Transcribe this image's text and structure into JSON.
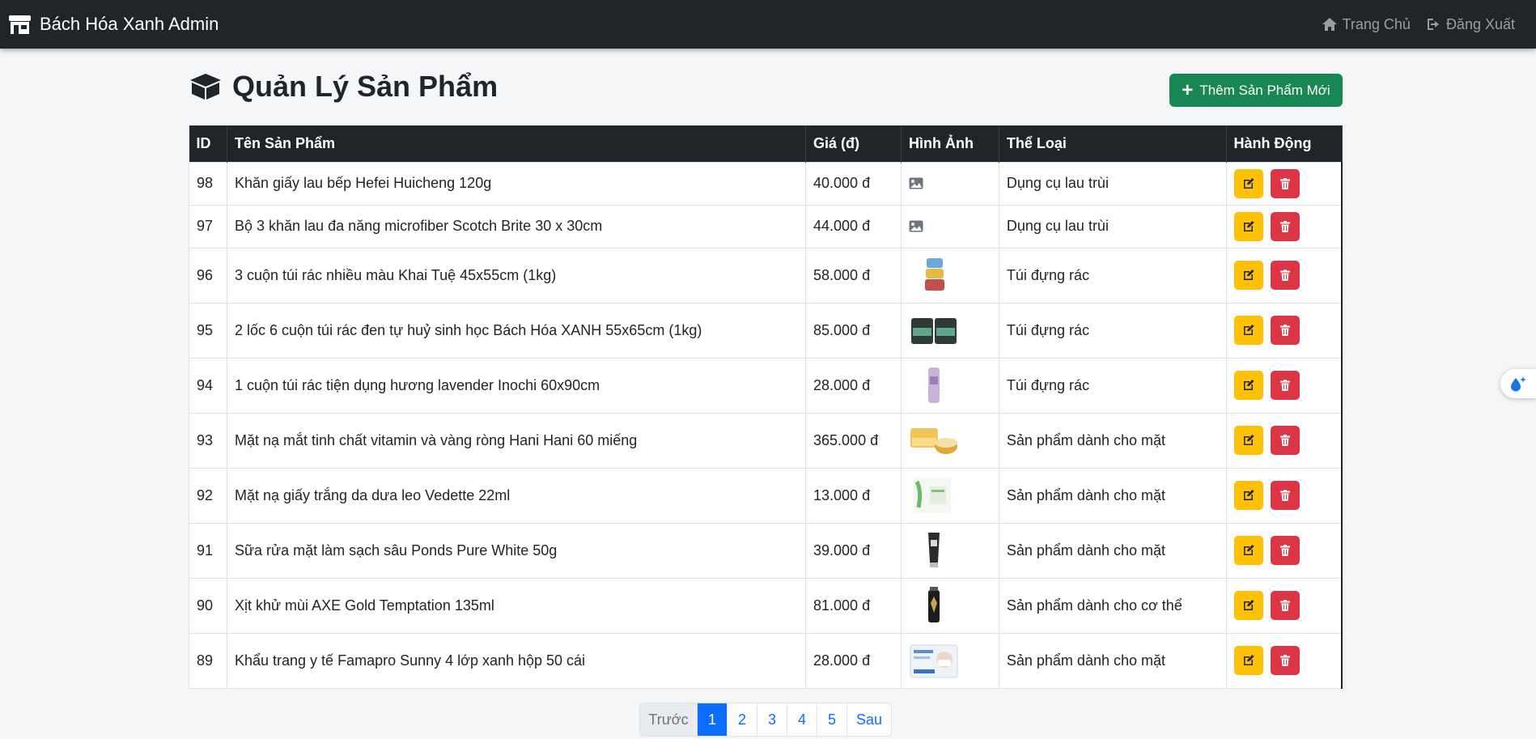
{
  "navbar": {
    "brand": "Bách Hóa Xanh Admin",
    "home_label": "Trang Chủ",
    "logout_label": "Đăng Xuất"
  },
  "page": {
    "title": "Quản Lý Sản Phẩm",
    "add_button": "Thêm Sản Phẩm Mới"
  },
  "table": {
    "headers": {
      "id": "ID",
      "name": "Tên Sản Phẩm",
      "price": "Giá (đ)",
      "image": "Hình Ảnh",
      "category": "Thể Loại",
      "actions": "Hành Động"
    },
    "rows": [
      {
        "id": "98",
        "name": "Khăn giấy lau bếp Hefei Huicheng 120g",
        "price": "40.000 đ",
        "image": "image-placeholder-icon",
        "category": "Dụng cụ lau trùi"
      },
      {
        "id": "97",
        "name": "Bộ 3 khăn lau đa năng microfiber Scotch Brite 30 x 30cm",
        "price": "44.000 đ",
        "image": "image-placeholder-icon",
        "category": "Dụng cụ lau trùi"
      },
      {
        "id": "96",
        "name": "3 cuộn túi rác nhiều màu Khai Tuệ 45x55cm (1kg)",
        "price": "58.000 đ",
        "image": "trash-bag-rolls",
        "category": "Túi đựng rác"
      },
      {
        "id": "95",
        "name": "2 lốc 6 cuộn túi rác đen tự huỷ sinh học Bách Hóa XANH 55x65cm (1kg)",
        "price": "85.000 đ",
        "image": "black-bag-packs",
        "category": "Túi đựng rác"
      },
      {
        "id": "94",
        "name": "1 cuộn túi rác tiện dụng hương lavender Inochi 60x90cm",
        "price": "28.000 đ",
        "image": "lavender-bag-roll",
        "category": "Túi đựng rác"
      },
      {
        "id": "93",
        "name": "Mặt nạ mắt tinh chất vitamin và vàng ròng Hani Hani 60 miếng",
        "price": "365.000 đ",
        "image": "eye-mask-jar",
        "category": "Sản phẩm dành cho mặt"
      },
      {
        "id": "92",
        "name": "Mặt nạ giấy trắng da dưa leo Vedette 22ml",
        "price": "13.000 đ",
        "image": "cucumber-mask",
        "category": "Sản phẩm dành cho mặt"
      },
      {
        "id": "91",
        "name": "Sữa rửa mặt làm sạch sâu Ponds Pure White 50g",
        "price": "39.000 đ",
        "image": "cleanser-tube",
        "category": "Sản phẩm dành cho mặt"
      },
      {
        "id": "90",
        "name": "Xịt khử mùi AXE Gold Temptation 135ml",
        "price": "81.000 đ",
        "image": "deodorant-can",
        "category": "Sản phẩm dành cho cơ thể"
      },
      {
        "id": "89",
        "name": "Khẩu trang y tế Famapro Sunny 4 lớp xanh hộp 50 cái",
        "price": "28.000 đ",
        "image": "face-mask-box",
        "category": "Sản phẩm dành cho mặt"
      }
    ]
  },
  "pagination": {
    "prev": "Trước",
    "pages": [
      "1",
      "2",
      "3",
      "4",
      "5"
    ],
    "active_page": "1",
    "next": "Sau"
  },
  "colors": {
    "navbar": "#212529",
    "add_button": "#198754",
    "edit_button": "#ffc107",
    "delete_button": "#dc3545",
    "active_page": "#0d6efd"
  }
}
